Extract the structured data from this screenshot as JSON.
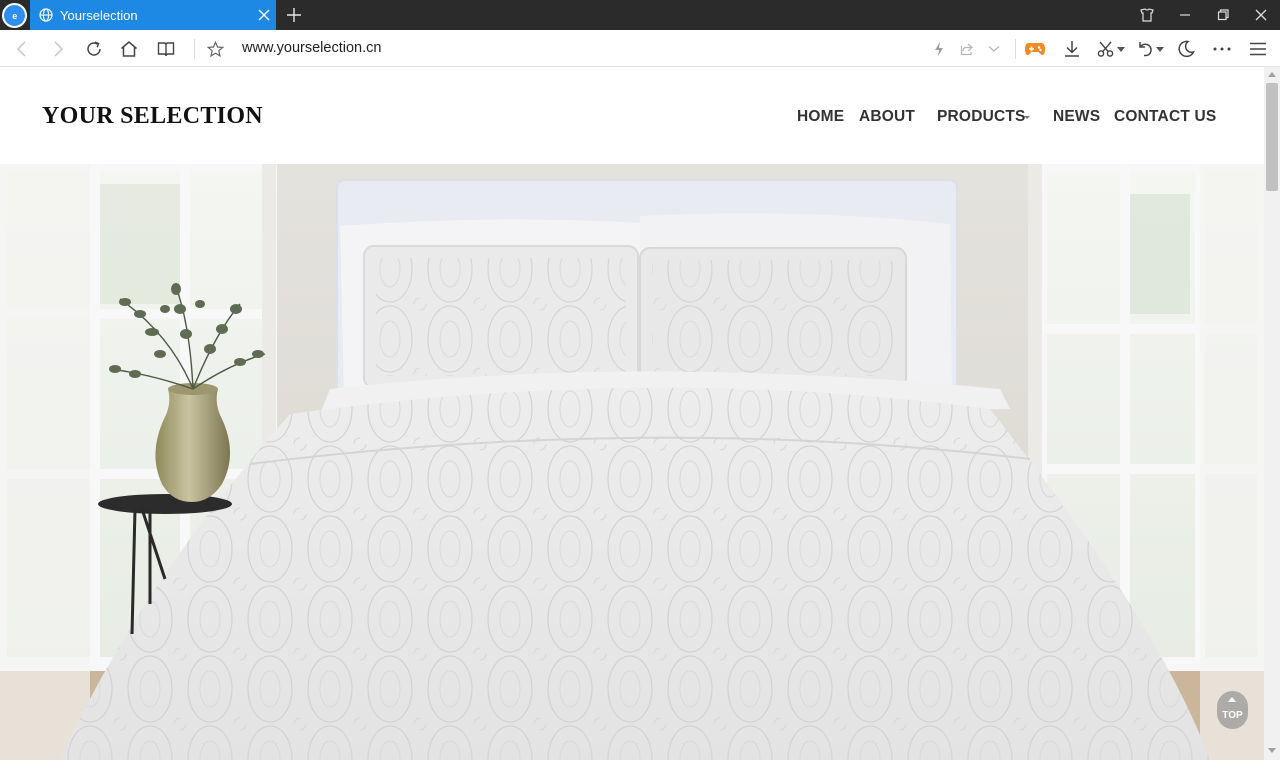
{
  "browser": {
    "tab_title": "Yourselection",
    "address": "www.yourselection.cn",
    "icons": {
      "browser_logo": "browser-logo-icon",
      "tab_favicon": "globe-icon",
      "tab_close": "close-icon",
      "new_tab": "plus-icon",
      "back": "back-arrow-icon",
      "forward": "forward-arrow-icon",
      "reload": "reload-icon",
      "home": "home-icon",
      "reading": "book-icon",
      "favorite": "star-icon",
      "speed": "lightning-icon",
      "share": "share-icon",
      "dropdown": "chevron-down-icon",
      "game": "gamepad-icon",
      "download": "download-icon",
      "screenshot": "scissors-icon",
      "undo": "undo-icon",
      "night_mode": "moon-icon",
      "more": "more-dots-icon",
      "menu": "hamburger-menu-icon",
      "skin": "shirt-icon",
      "minimize": "minimize-icon",
      "maximize": "restore-icon",
      "close": "window-close-icon"
    },
    "colors": {
      "tab_active": "#1e88e5",
      "titlebar": "#2b2b2b",
      "game_icon": "#f08a24"
    }
  },
  "site": {
    "logo_text": "YOUR SELECTION",
    "nav": {
      "home": "HOME",
      "about": "ABOUT",
      "products": "PRODUCTS",
      "news": "NEWS",
      "contact": "CONTACT US"
    },
    "back_to_top": "TOP"
  }
}
